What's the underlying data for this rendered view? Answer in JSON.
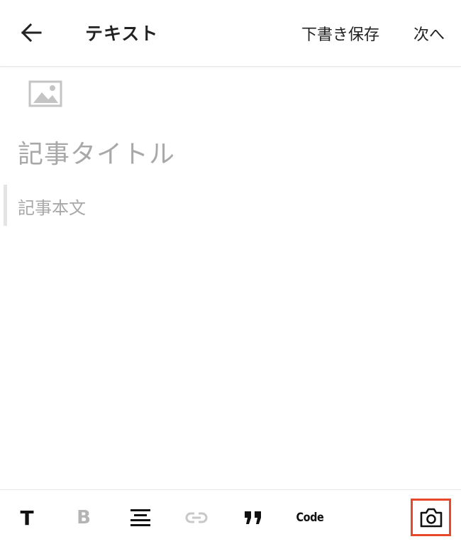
{
  "header": {
    "title": "テキスト",
    "draft_label": "下書き保存",
    "next_label": "次へ",
    "back_icon": "arrow-left-icon"
  },
  "editor": {
    "image_icon": "image-placeholder-icon",
    "title_placeholder": "記事タイトル",
    "body_placeholder": "記事本文"
  },
  "toolbar": {
    "text_label": "T",
    "bold_label": "B",
    "code_label": "Code",
    "icons": [
      "text-style-icon",
      "bold-icon",
      "align-center-icon",
      "link-icon",
      "quote-icon",
      "code-icon",
      "camera-icon"
    ]
  },
  "colors": {
    "highlight_border": "#e8482a",
    "placeholder_text": "#a8a8a8",
    "disabled_icon": "#b4b4b4",
    "active_icon": "#111111"
  }
}
